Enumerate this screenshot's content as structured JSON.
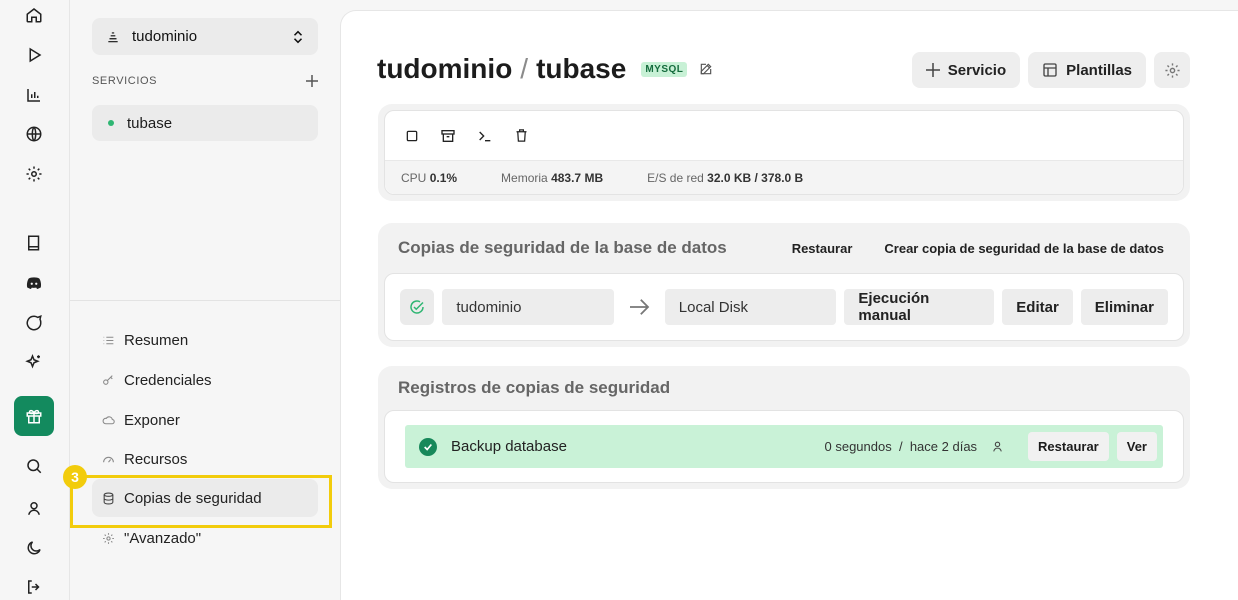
{
  "rail": {
    "items": [
      "home-icon",
      "play-icon",
      "chart-icon",
      "globe-icon",
      "gear-icon",
      "book-icon",
      "discord-icon",
      "chat-icon",
      "sparkles-icon",
      "gift-icon",
      "search-icon",
      "user-icon",
      "moon-icon",
      "logout-icon"
    ]
  },
  "sidebar": {
    "project_name": "tudominio",
    "services_header": "SERVICIOS",
    "service_name": "tubase",
    "menu": [
      {
        "label": "Resumen"
      },
      {
        "label": "Credenciales"
      },
      {
        "label": "Exponer"
      },
      {
        "label": "Recursos"
      },
      {
        "label": "Copias de seguridad"
      },
      {
        "label": "\"Avanzado\""
      }
    ],
    "step_badge": "3"
  },
  "header": {
    "project": "tudominio",
    "separator": "/",
    "service": "tubase",
    "db_type": "MYSQL",
    "service_button": "Servicio",
    "templates_button": "Plantillas"
  },
  "stats": {
    "cpu_label": "CPU",
    "cpu_value": "0.1%",
    "mem_label": "Memoria",
    "mem_value": "483.7 MB",
    "net_label": "E/S de red",
    "net_value": "32.0 KB / 378.0 B"
  },
  "backups": {
    "title": "Copias de seguridad de la base de datos",
    "restore_label": "Restaurar",
    "create_label": "Crear copia de seguridad de la base de datos",
    "source": "tudominio",
    "destination": "Local Disk",
    "run_label": "Ejecución manual",
    "edit_label": "Editar",
    "delete_label": "Eliminar"
  },
  "logs": {
    "title": "Registros de copias de seguridad",
    "entry_name": "Backup database",
    "duration": "0 segundos",
    "divider": "/",
    "when": "hace 2 días",
    "restore_label": "Restaurar",
    "view_label": "Ver"
  },
  "colors": {
    "accent": "#138a5e",
    "success_bg": "#c9f2d7",
    "highlight": "#f2cc0c"
  }
}
